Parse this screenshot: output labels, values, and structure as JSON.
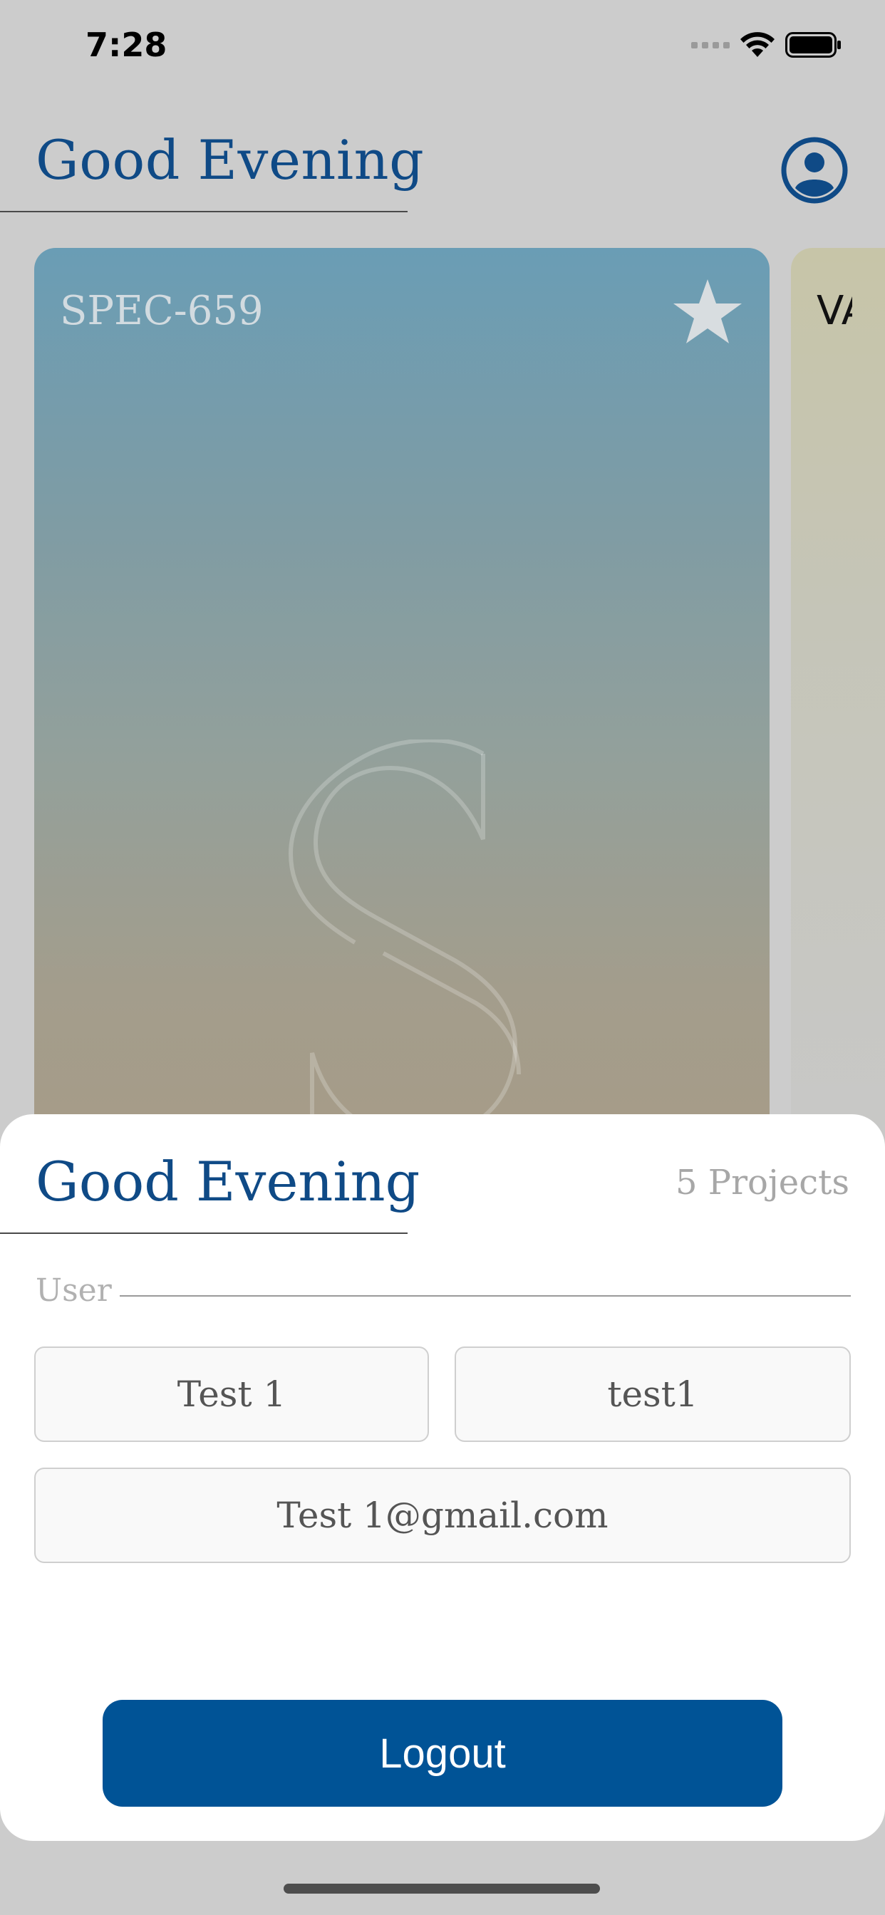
{
  "status_bar": {
    "time": "7:28"
  },
  "header": {
    "greeting": "Good Evening",
    "profile_icon": "user-circle-icon"
  },
  "cards": [
    {
      "code": "SPEC-659",
      "favorite_icon": "star-icon",
      "watermark": "S"
    },
    {
      "code": "VA"
    }
  ],
  "sheet": {
    "greeting": "Good Evening",
    "projects_count": "5 Projects",
    "user_section_label": "User",
    "first_name": "Test 1",
    "username": "test1",
    "email": "Test 1@gmail.com",
    "logout_label": "Logout"
  },
  "colors": {
    "brand_blue": "#005396",
    "title_blue": "#0f4a86",
    "background": "#cccccc"
  }
}
